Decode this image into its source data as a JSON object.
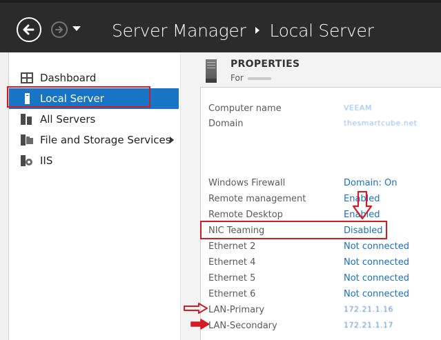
{
  "titlebar": {
    "crumbs": [
      "Server Manager",
      "Local Server"
    ]
  },
  "sidebar": {
    "items": [
      {
        "label": "Dashboard",
        "icon": "dashboard-icon"
      },
      {
        "label": "Local Server",
        "icon": "server-icon",
        "selected": true
      },
      {
        "label": "All Servers",
        "icon": "servers-icon"
      },
      {
        "label": "File and Storage Services",
        "icon": "storage-icon",
        "expandable": true
      },
      {
        "label": "IIS",
        "icon": "iis-icon"
      }
    ]
  },
  "properties": {
    "title": "PROPERTIES",
    "subtitle_prefix": "For",
    "rows": [
      {
        "key": "Computer name",
        "value": "VEEAM"
      },
      {
        "key": "Domain",
        "value": "thesmartcube.net"
      },
      {
        "key": "Windows Firewall",
        "value": "Domain: On"
      },
      {
        "key": "Remote management",
        "value": "Enabled"
      },
      {
        "key": "Remote Desktop",
        "value": "Enabled"
      },
      {
        "key": "NIC Teaming",
        "value": "Disabled"
      },
      {
        "key": "Ethernet 2",
        "value": "Not connected"
      },
      {
        "key": "Ethernet 4",
        "value": "Not connected"
      },
      {
        "key": "Ethernet 5",
        "value": "Not connected"
      },
      {
        "key": "Ethernet 6",
        "value": "Not connected"
      },
      {
        "key": "LAN-Primary",
        "value": "172.21.1.16"
      },
      {
        "key": "LAN-Secondary",
        "value": "172.21.1.17"
      }
    ]
  },
  "colors": {
    "titlebar_bg": "#2b2b2b",
    "selection_blue": "#1874c5",
    "link_blue": "#1a6fc2",
    "annotation_red": "#d41b24"
  }
}
